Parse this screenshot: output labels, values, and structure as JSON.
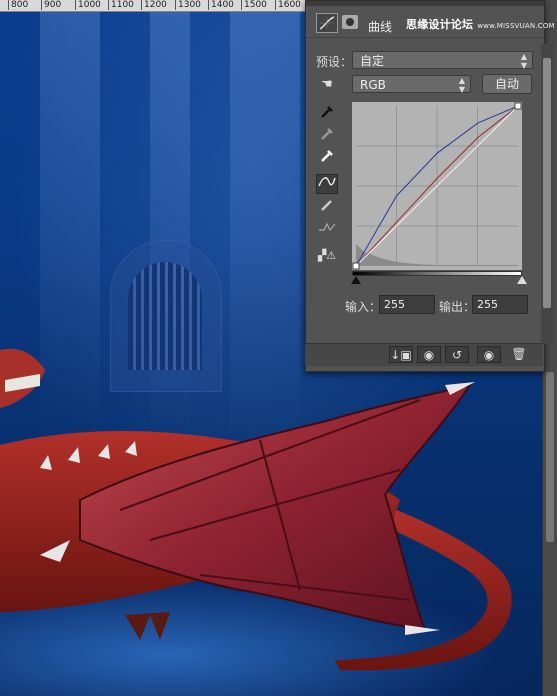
{
  "ruler": {
    "ticks": [
      "800",
      "900",
      "1000",
      "1100",
      "1200",
      "1300",
      "1400",
      "1500",
      "1600"
    ]
  },
  "panel": {
    "title": "曲线",
    "watermark": "思缘设计论坛",
    "watermark_url": "www.MISSVUAN.COM",
    "preset_label": "预设：",
    "preset_value": "自定",
    "channel_value": "RGB",
    "auto_button": "自动",
    "input_label": "输入：",
    "input_value": "255",
    "output_label": "输出：",
    "output_value": "255"
  },
  "curves": {
    "type": "curve",
    "x_range": [
      0,
      255
    ],
    "y_range": [
      0,
      255
    ],
    "channels": [
      {
        "name": "RGB",
        "color": "#e8e8e8",
        "points": [
          [
            0,
            0
          ],
          [
            255,
            255
          ]
        ]
      },
      {
        "name": "Blue",
        "color": "#2a3a9a",
        "points": [
          [
            0,
            0
          ],
          [
            64,
            112
          ],
          [
            128,
            180
          ],
          [
            192,
            228
          ],
          [
            255,
            255
          ]
        ]
      },
      {
        "name": "Red",
        "color": "#9a2a2a",
        "points": [
          [
            0,
            0
          ],
          [
            64,
            70
          ],
          [
            128,
            140
          ],
          [
            192,
            205
          ],
          [
            255,
            255
          ]
        ]
      }
    ]
  },
  "icons": {
    "curves_adjustment": "curves-icon",
    "mask": "mask-icon",
    "hand": "hand-icon",
    "eyedropper_black": "eyedropper-black-icon",
    "eyedropper_gray": "eyedropper-gray-icon",
    "eyedropper_white": "eyedropper-white-icon",
    "curve_tool": "curve-tool-icon",
    "pencil": "pencil-icon",
    "smooth": "smooth-icon",
    "clipping_warning": "clipping-warning-icon",
    "clip_to_layer": "clip-layer-icon",
    "view_previous": "view-previous-icon",
    "reset": "reset-icon",
    "visibility": "eye-icon",
    "delete": "trash-icon"
  }
}
